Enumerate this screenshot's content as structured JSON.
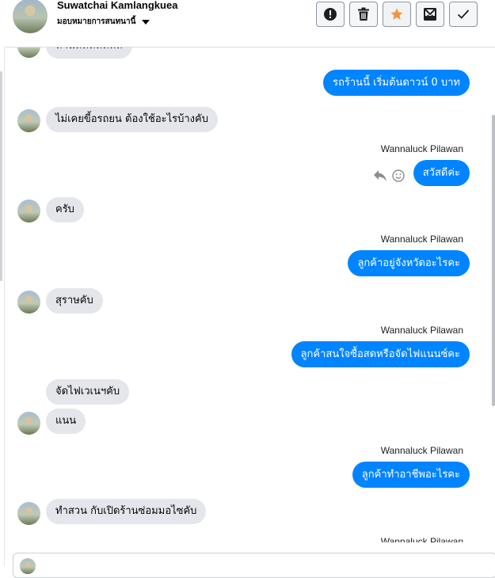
{
  "header": {
    "name": "Suwatchai Kamlangkuea",
    "subtitle": "มอบหมายการสนทนานี้"
  },
  "actions": [
    {
      "icon": "alert-icon"
    },
    {
      "icon": "trash-icon"
    },
    {
      "icon": "star-icon",
      "color": "#f7923b"
    },
    {
      "icon": "move-to-inbox-icon"
    },
    {
      "icon": "check-icon"
    }
  ],
  "colors": {
    "outgoing": "#0084ff",
    "incoming": "#e4e6eb",
    "star": "#f7923b"
  },
  "messages": [
    {
      "direction": "out",
      "text": "รถร้านนี้ เริ่มต้นดาวน์ 0 บาท"
    },
    {
      "direction": "in",
      "text": "ไม่เคยขี้อรถยน ต้องใช้อะไรบ้างคับ"
    },
    {
      "direction": "out",
      "sender": "Wannaluck Pilawan",
      "text": "สวัสดีค่ะ"
    },
    {
      "direction": "in",
      "text": "ครับ"
    },
    {
      "direction": "out",
      "sender": "Wannaluck Pilawan",
      "text": "ลูกค้าอยู่จังหวัดอะไรคะ"
    },
    {
      "direction": "in",
      "text": "สุราษคับ"
    },
    {
      "direction": "out",
      "sender": "Wannaluck Pilawan",
      "text": "ลูกค้าสนใจซื้อสดหรือจัดไฟแนนซ์คะ"
    },
    {
      "direction": "in",
      "text": "จัดไฟเวเนฯคับ"
    },
    {
      "direction": "in",
      "text": "แนน"
    },
    {
      "direction": "out",
      "sender": "Wannaluck Pilawan",
      "text": "ลูกค้าทำอาชีพอะไรคะ"
    },
    {
      "direction": "in",
      "text": "ทำสวน กับเปิดร้านซ่อมมอไซคับ"
    },
    {
      "direction": "out",
      "sender": "Wannaluck Pilawan",
      "text": ""
    }
  ]
}
